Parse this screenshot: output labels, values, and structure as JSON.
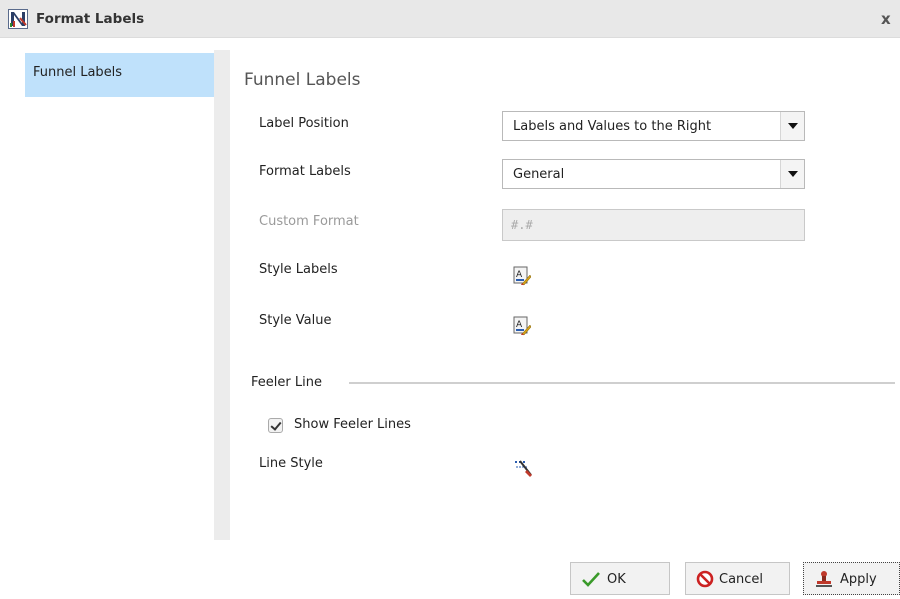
{
  "window": {
    "title": "Format Labels",
    "close_label": "x"
  },
  "sidebar": {
    "items": [
      {
        "label": "Funnel Labels",
        "selected": true
      }
    ]
  },
  "main": {
    "section_title": "Funnel Labels",
    "label_position": {
      "label": "Label Position",
      "value": "Labels and Values to the Right"
    },
    "format_labels": {
      "label": "Format Labels",
      "value": "General"
    },
    "custom_format": {
      "label": "Custom Format",
      "value": "#.#",
      "disabled": true
    },
    "style_labels": {
      "label": "Style Labels",
      "icon": "style-text-icon"
    },
    "style_value": {
      "label": "Style Value",
      "icon": "style-text-icon"
    },
    "feeler_line": {
      "group_title": "Feeler Line",
      "show_feeler_lines": {
        "label": "Show Feeler Lines",
        "checked": true
      },
      "line_style": {
        "label": "Line Style",
        "icon": "line-style-icon"
      }
    }
  },
  "footer": {
    "ok_label": "OK",
    "cancel_label": "Cancel",
    "apply_label": "Apply"
  },
  "colors": {
    "selected_item_bg": "#bfe1fb",
    "titlebar_bg": "#e8e8e8",
    "ok_check": "#3a9a2a",
    "cancel_icon": "#cc2222"
  }
}
